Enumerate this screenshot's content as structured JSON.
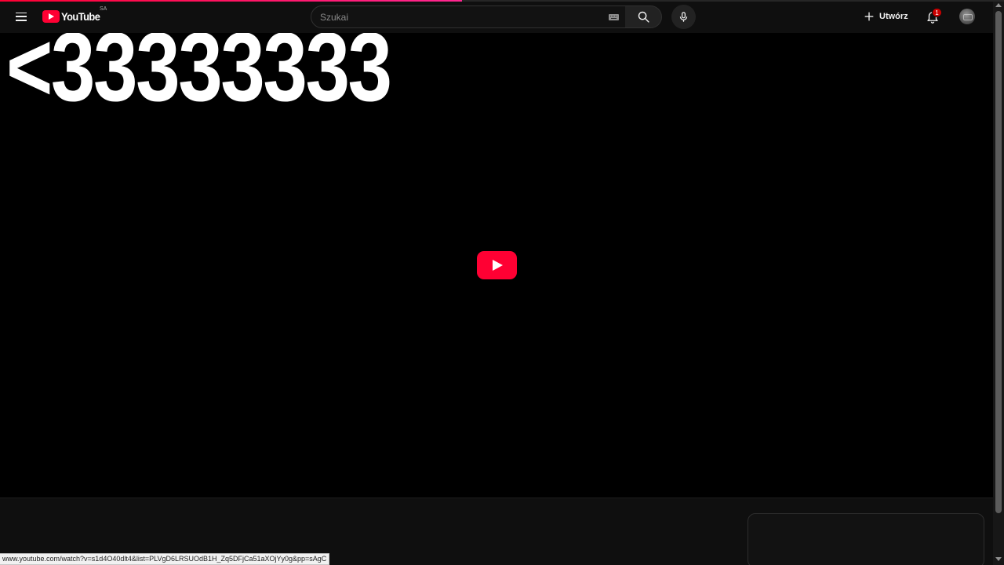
{
  "header": {
    "logo_text": "YouTube",
    "logo_country": "SA",
    "search_placeholder": "Szukai",
    "create_label": "Utwórz",
    "notification_count": "1"
  },
  "player": {
    "overlay_text": "<33333333",
    "progress_fraction": 0.46
  },
  "status_bar": {
    "url": "www.youtube.com/watch?v=s1d4O40dlt4&list=PLVgD6LRSUOdB1H_Zq5DFjCa51aXOjYy0g&pp=sAgC"
  },
  "colors": {
    "background": "#0f0f0f",
    "brand_red": "#ff0033",
    "progress_accent": "#ff2791"
  },
  "icons": [
    "menu-icon",
    "youtube-logo-icon",
    "keyboard-icon",
    "search-icon",
    "microphone-icon",
    "plus-icon",
    "bell-icon",
    "play-icon"
  ]
}
